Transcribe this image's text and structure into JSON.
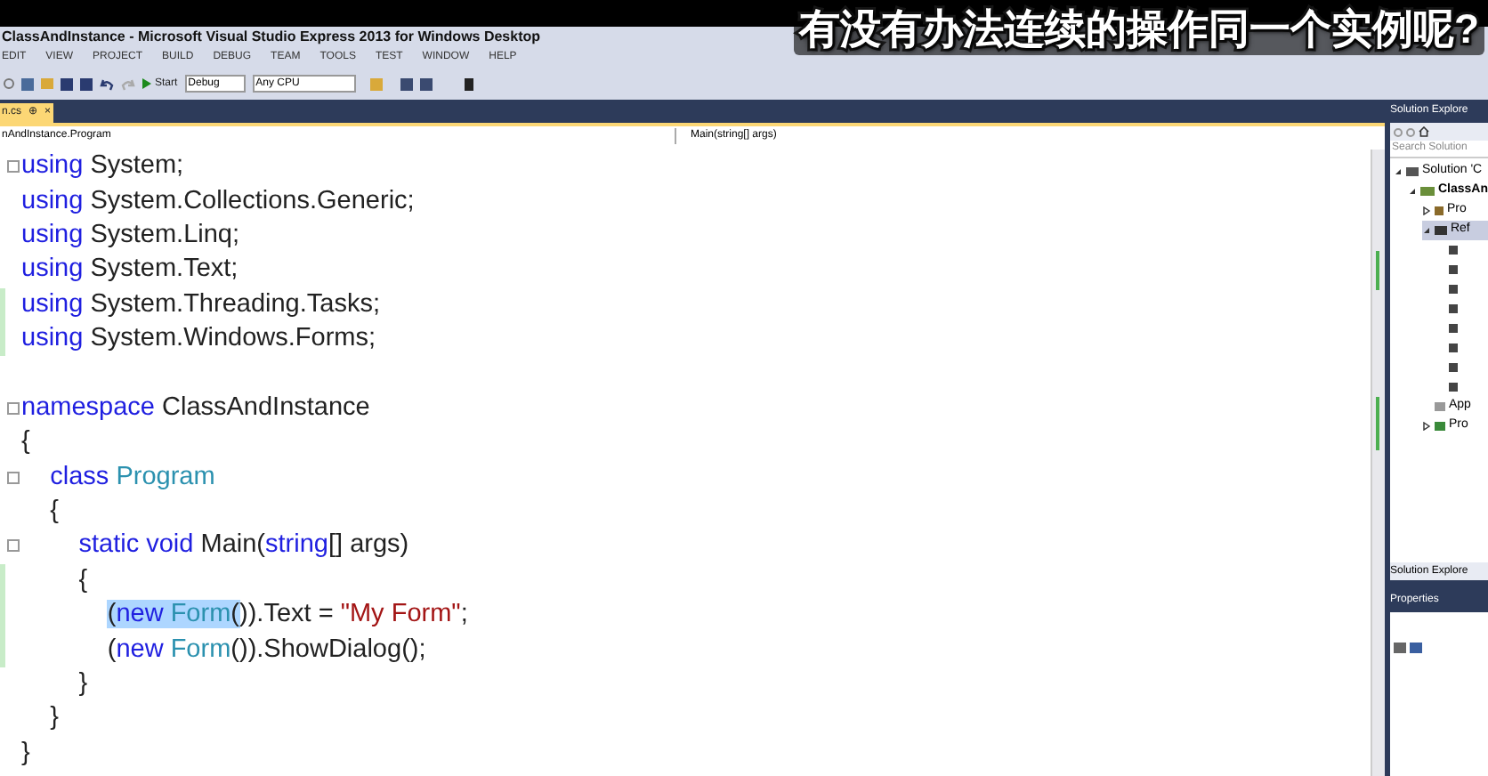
{
  "subtitle": "有没有办法连续的操作同一个实例呢?",
  "window": {
    "title": "ClassAndInstance - Microsoft Visual Studio Express 2013 for Windows Desktop"
  },
  "menu": [
    "EDIT",
    "VIEW",
    "PROJECT",
    "BUILD",
    "DEBUG",
    "TEAM",
    "TOOLS",
    "TEST",
    "WINDOW",
    "HELP"
  ],
  "toolbar": {
    "start": "Start",
    "configuration": "Debug",
    "platform": "Any CPU"
  },
  "tab": {
    "label": "n.cs",
    "pin": "⊕",
    "close": "×"
  },
  "navbar": {
    "left": "nAndInstance.Program",
    "right": "Main(string[] args)"
  },
  "code": [
    {
      "fold": true,
      "changed": false,
      "tokens": [
        {
          "kind": "kw",
          "text": "using"
        },
        {
          "kind": "plain",
          "text": " System;"
        }
      ]
    },
    {
      "fold": false,
      "changed": false,
      "tokens": [
        {
          "kind": "kw",
          "text": "using"
        },
        {
          "kind": "plain",
          "text": " System.Collections.Generic;"
        }
      ]
    },
    {
      "fold": false,
      "changed": false,
      "tokens": [
        {
          "kind": "kw",
          "text": "using"
        },
        {
          "kind": "plain",
          "text": " System.Linq;"
        }
      ]
    },
    {
      "fold": false,
      "changed": false,
      "tokens": [
        {
          "kind": "kw",
          "text": "using"
        },
        {
          "kind": "plain",
          "text": " System.Text;"
        }
      ]
    },
    {
      "fold": false,
      "changed": true,
      "tokens": [
        {
          "kind": "kw",
          "text": "using"
        },
        {
          "kind": "plain",
          "text": " System.Threading.Tasks;"
        }
      ]
    },
    {
      "fold": false,
      "changed": true,
      "tokens": [
        {
          "kind": "kw",
          "text": "using"
        },
        {
          "kind": "plain",
          "text": " System.Windows.Forms;"
        }
      ]
    },
    {
      "fold": false,
      "changed": false
    },
    {
      "fold": true,
      "changed": false,
      "tokens": [
        {
          "kind": "kw",
          "text": "namespace"
        },
        {
          "kind": "plain",
          "text": " ClassAndInstance"
        }
      ]
    },
    {
      "fold": false,
      "changed": false,
      "tokens": [
        {
          "kind": "plain",
          "text": "{"
        }
      ]
    },
    {
      "fold": true,
      "changed": false,
      "tokens": [
        {
          "kind": "kw",
          "text": "    class"
        },
        {
          "kind": "type",
          "text": " Program"
        }
      ]
    },
    {
      "fold": false,
      "changed": false,
      "tokens": [
        {
          "kind": "plain",
          "text": "    {"
        }
      ]
    },
    {
      "fold": true,
      "changed": false,
      "tokens": [
        {
          "kind": "kw",
          "text": "        static void"
        },
        {
          "kind": "plain",
          "text": " Main("
        },
        {
          "kind": "kw",
          "text": "string"
        },
        {
          "kind": "plain",
          "text": "[] args)"
        }
      ]
    },
    {
      "fold": false,
      "changed": true,
      "tokens": [
        {
          "kind": "plain",
          "text": "        {"
        }
      ]
    },
    {
      "fold": false,
      "changed": true,
      "tokens": [
        {
          "kind": "plain",
          "text": "            (",
          "selected": true
        },
        {
          "kind": "kw",
          "text": "new ",
          "selected": true
        },
        {
          "kind": "type",
          "text": "Form",
          "selected": true
        },
        {
          "kind": "plain",
          "text": "(",
          "selected": true
        },
        {
          "kind": "plain",
          "text": ")).Text = ",
          "selected": false
        },
        {
          "kind": "str",
          "text": "\"My Form\"",
          "selected": false
        },
        {
          "kind": "plain",
          "text": ";",
          "selected": false
        }
      ]
    },
    {
      "fold": false,
      "changed": true,
      "tokens": [
        {
          "kind": "plain",
          "text": "            ("
        },
        {
          "kind": "kw",
          "text": "new"
        },
        {
          "kind": "type",
          "text": " Form"
        },
        {
          "kind": "plain",
          "text": "()).ShowDialog();"
        }
      ]
    },
    {
      "fold": false,
      "changed": false,
      "tokens": [
        {
          "kind": "plain",
          "text": "        }"
        }
      ]
    },
    {
      "fold": false,
      "changed": false,
      "tokens": [
        {
          "kind": "plain",
          "text": "    }"
        }
      ]
    },
    {
      "fold": false,
      "changed": false,
      "tokens": [
        {
          "kind": "plain",
          "text": "}"
        }
      ]
    }
  ],
  "solution_explorer": {
    "title": "Solution Explore",
    "search": {
      "placeholder": "Search Solution"
    },
    "tree": [
      {
        "label": "Solution 'C",
        "kind": "solution",
        "expanded": true,
        "selected": false,
        "children": [
          {
            "label": "ClassAn",
            "kind": "project",
            "expanded": true,
            "selected": false,
            "children": [
              {
                "label": "Pro",
                "kind": "properties",
                "expanded": false,
                "selected": false
              },
              {
                "label": "Ref",
                "kind": "references",
                "expanded": true,
                "selected": true,
                "children": [
                  {
                    "kind": "reference",
                    "selected": false
                  },
                  {
                    "kind": "reference",
                    "selected": false
                  },
                  {
                    "kind": "reference",
                    "selected": false
                  },
                  {
                    "kind": "reference",
                    "selected": false
                  },
                  {
                    "kind": "reference",
                    "selected": false
                  },
                  {
                    "kind": "reference",
                    "selected": false
                  },
                  {
                    "kind": "reference",
                    "selected": false
                  },
                  {
                    "kind": "reference",
                    "selected": false
                  }
                ]
              },
              {
                "label": "App",
                "kind": "config",
                "selected": false
              },
              {
                "label": "Pro",
                "kind": "file",
                "expanded": false,
                "selected": false
              }
            ]
          }
        ]
      }
    ],
    "footer_tab": "Solution Explore"
  },
  "properties": {
    "title": "Properties"
  }
}
